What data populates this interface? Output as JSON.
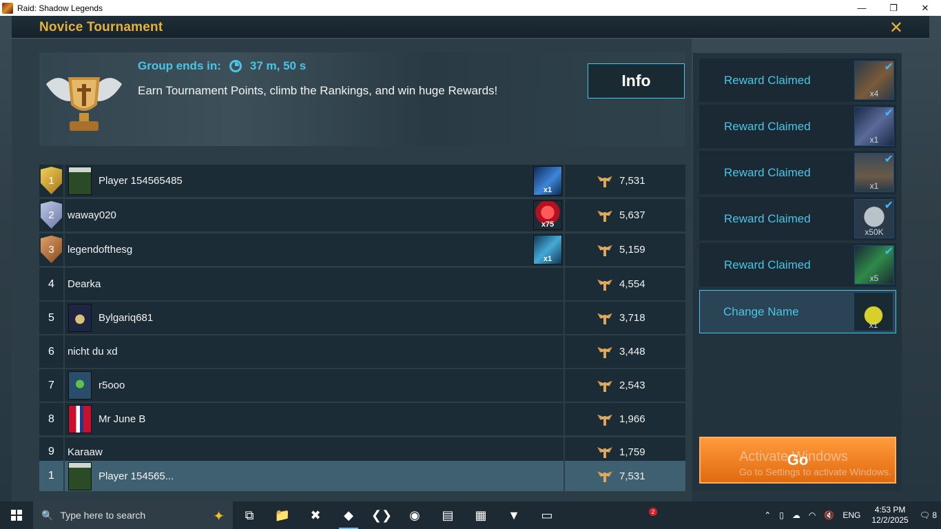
{
  "window": {
    "title": "Raid: Shadow Legends",
    "minimize": "—",
    "maximize": "❐",
    "close": "✕"
  },
  "header": {
    "title": "Novice Tournament",
    "close": "✕"
  },
  "banner": {
    "group_ends_label": "Group ends in:",
    "timer": "37 m, 50 s",
    "description": "Earn Tournament Points, climb the Rankings, and win huge Rewards!",
    "info_button": "Info"
  },
  "leaderboard": [
    {
      "rank": "1",
      "name": "Player 154565485",
      "score": "7,531",
      "reward_qty": "x1"
    },
    {
      "rank": "2",
      "name": "waway020",
      "score": "5,637",
      "reward_qty": "x75"
    },
    {
      "rank": "3",
      "name": "legendofthesg",
      "score": "5,159",
      "reward_qty": "x1"
    },
    {
      "rank": "4",
      "name": "Dearka",
      "score": "4,554"
    },
    {
      "rank": "5",
      "name": "Bylgariq681",
      "score": "3,718"
    },
    {
      "rank": "6",
      "name": "nicht du xd",
      "score": "3,448"
    },
    {
      "rank": "7",
      "name": "r5ooo",
      "score": "2,543"
    },
    {
      "rank": "8",
      "name": "Mr June B",
      "score": "1,966"
    },
    {
      "rank": "9",
      "name": "Karaaw",
      "score": "1,759"
    }
  ],
  "my_row": {
    "rank": "1",
    "name": "Player 154565...",
    "score": "7,531"
  },
  "rewards": [
    {
      "label": "Reward Claimed",
      "qty": "x4",
      "check": "✔"
    },
    {
      "label": "Reward Claimed",
      "qty": "x1",
      "check": "✔"
    },
    {
      "label": "Reward Claimed",
      "qty": "x1",
      "check": "✔"
    },
    {
      "label": "Reward Claimed",
      "qty": "x50K",
      "check": "✔"
    },
    {
      "label": "Reward Claimed",
      "qty": "x5",
      "check": "✔"
    },
    {
      "label": "Change Name",
      "qty": "x1"
    }
  ],
  "go_button": "Go",
  "watermark": {
    "line1": "Activate Windows",
    "line2": "Go to Settings to activate Windows."
  },
  "taskbar": {
    "search_placeholder": "Type here to search",
    "notification_count": "2",
    "language": "ENG",
    "time": "4:53 PM",
    "date": "12/2/2025",
    "action_center_count": "8"
  }
}
